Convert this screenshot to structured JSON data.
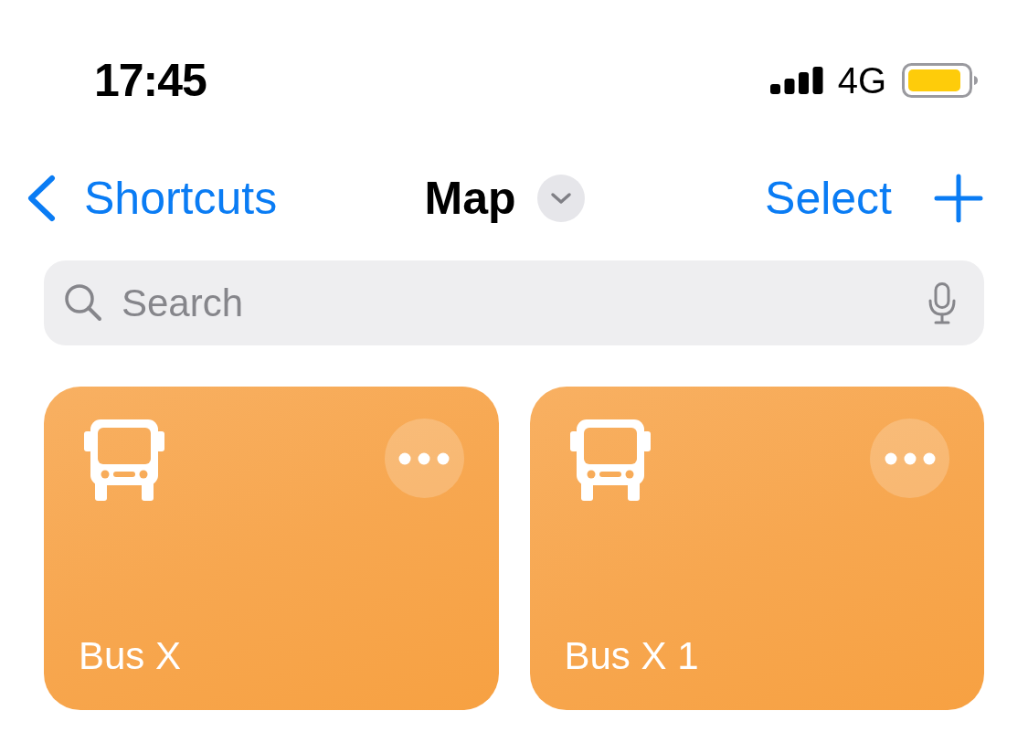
{
  "status_bar": {
    "time": "17:45",
    "network": "4G",
    "low_power_mode": true
  },
  "nav": {
    "back_label": "Shortcuts",
    "title": "Map",
    "action": "Select"
  },
  "search": {
    "placeholder": "Search"
  },
  "shortcuts": [
    {
      "name": "Bus X"
    },
    {
      "name": "Bus X 1"
    }
  ]
}
